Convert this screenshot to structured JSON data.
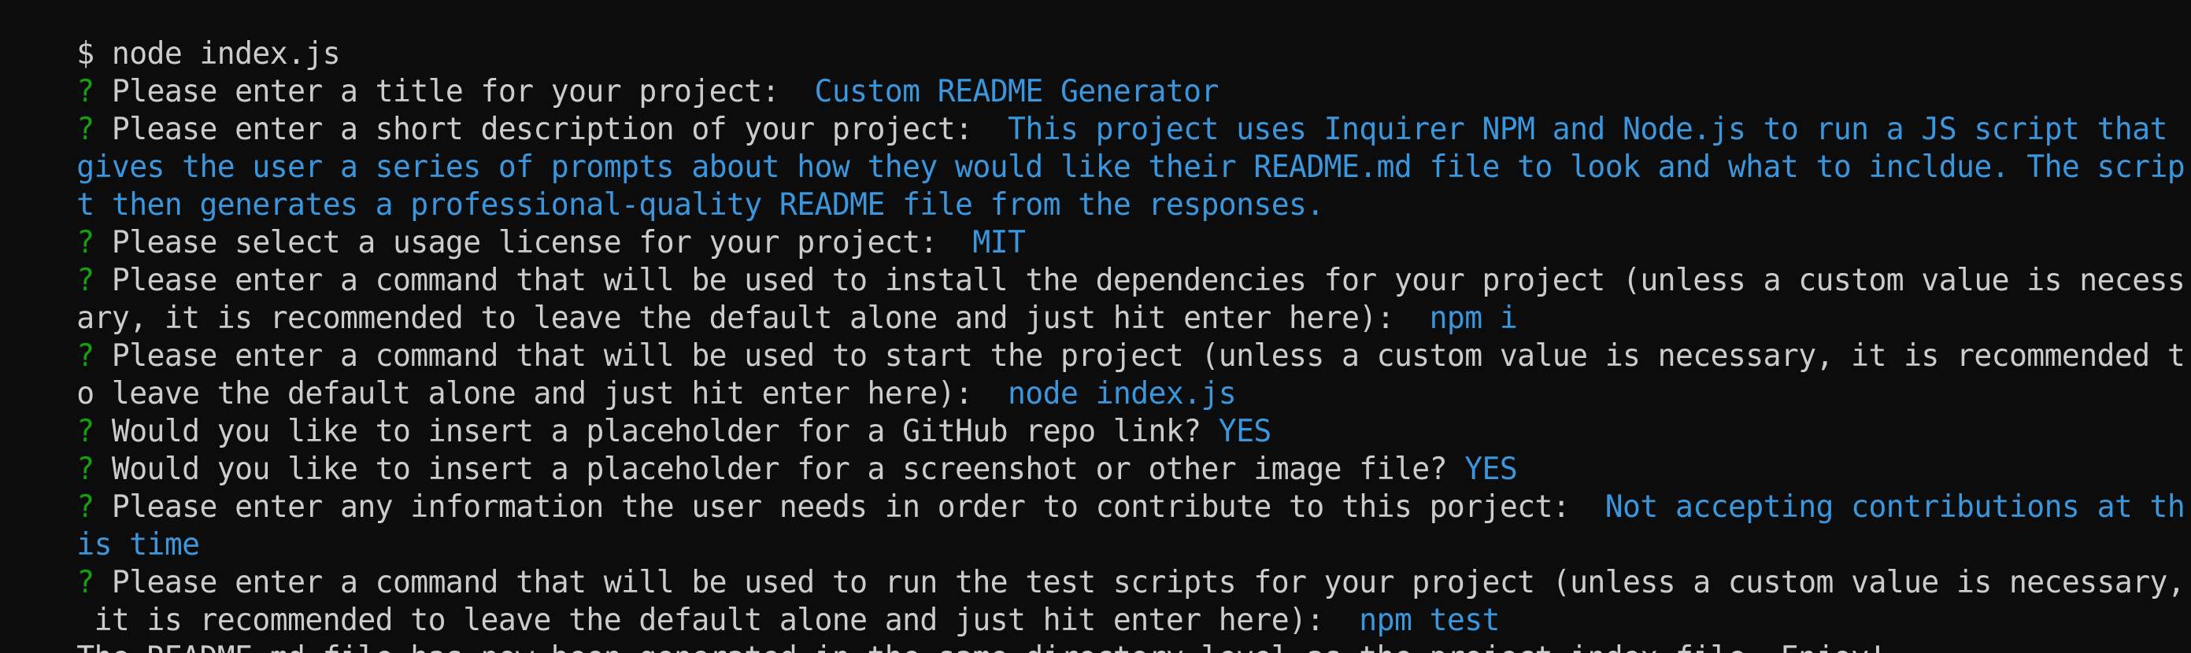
{
  "colors": {
    "background": "#0c0c0c",
    "text": "#cccccc",
    "prompt_marker": "#13a10e",
    "answer": "#3a96dd"
  },
  "terminal": {
    "command": "$ node index.js",
    "prompts": [
      {
        "marker": "?",
        "question": " Please enter a title for your project:  ",
        "answer_line1": "Custom README Generator"
      },
      {
        "marker": "?",
        "question": " Please enter a short description of your project:  ",
        "answer_line1": "This project uses Inquirer NPM and Node.js to run a JS script that",
        "answer_line2": "gives the user a series of prompts about how they would like their README.md file to look and what to incldue. The scrip",
        "answer_line3": "t then generates a professional-quality README file from the responses."
      },
      {
        "marker": "?",
        "question": " Please select a usage license for your project:  ",
        "answer_line1": "MIT"
      },
      {
        "marker": "?",
        "question_line1": " Please enter a command that will be used to install the dependencies for your project (unless a custom value is necess",
        "question_line2": "ary, it is recommended to leave the default alone and just hit enter here):  ",
        "answer_line1": "npm i"
      },
      {
        "marker": "?",
        "question_line1": " Please enter a command that will be used to start the project (unless a custom value is necessary, it is recommended t",
        "question_line2": "o leave the default alone and just hit enter here):  ",
        "answer_line1": "node index.js"
      },
      {
        "marker": "?",
        "question": " Would you like to insert a placeholder for a GitHub repo link? ",
        "answer_line1": "YES"
      },
      {
        "marker": "?",
        "question": " Would you like to insert a placeholder for a screenshot or other image file? ",
        "answer_line1": "YES"
      },
      {
        "marker": "?",
        "question": " Please enter any information the user needs in order to contribute to this porject:  ",
        "answer_line1": "Not accepting contributions at th",
        "answer_line2": "is time"
      },
      {
        "marker": "?",
        "question_line1": " Please enter a command that will be used to run the test scripts for your project (unless a custom value is necessary,",
        "question_line2": " it is recommended to leave the default alone and just hit enter here):  ",
        "answer_line1": "npm test"
      }
    ],
    "final_message": "The README.md file has now been generated in the same directory level as the project index file. Enjoy!"
  }
}
